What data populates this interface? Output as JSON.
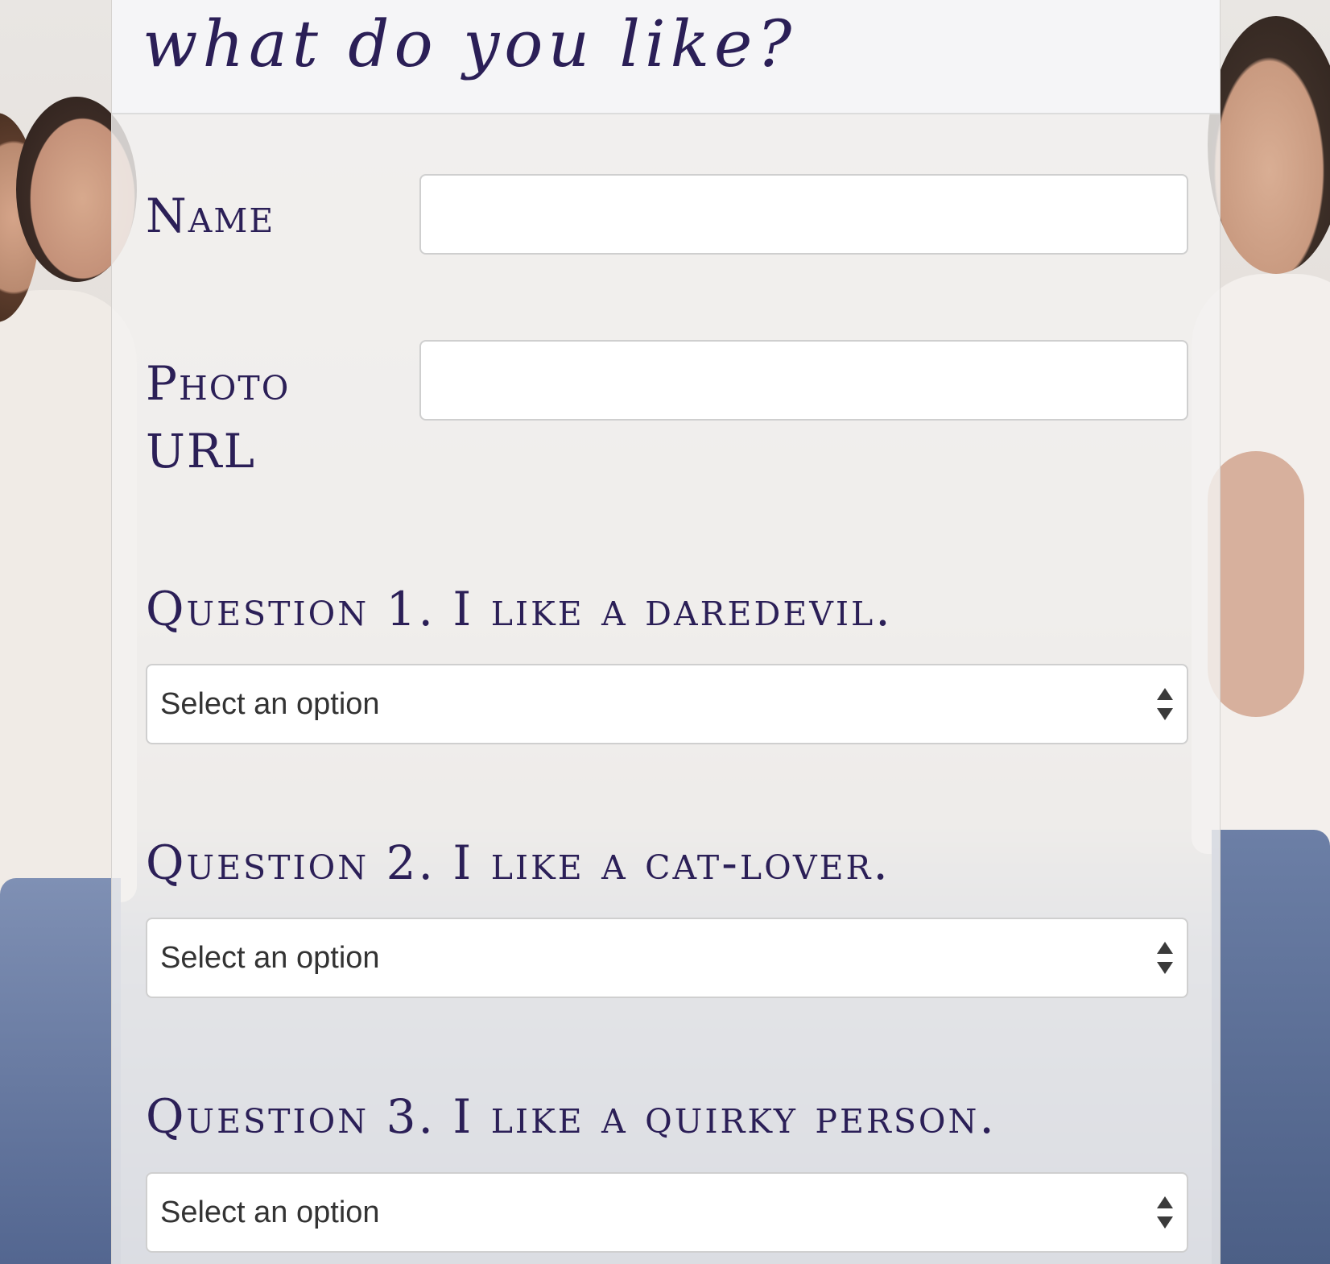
{
  "header": {
    "title": "what do you like?"
  },
  "form": {
    "name_label": "Name",
    "name_value": "",
    "photo_label_line1": "Photo",
    "photo_label_line2": "URL",
    "photo_value": "",
    "questions": [
      {
        "label": "Question 1. I like a daredevil.",
        "selected": "Select an option"
      },
      {
        "label": "Question 2. I like a cat-lover.",
        "selected": "Select an option"
      },
      {
        "label": "Question 3. I like a quirky person.",
        "selected": "Select an option"
      }
    ]
  },
  "icons": {
    "select_arrows": "up-down-chevron-icon"
  },
  "colors": {
    "text_accent": "#2b1f57",
    "panel_bg": "#f3f1f0",
    "input_border": "#cfcfcf"
  }
}
